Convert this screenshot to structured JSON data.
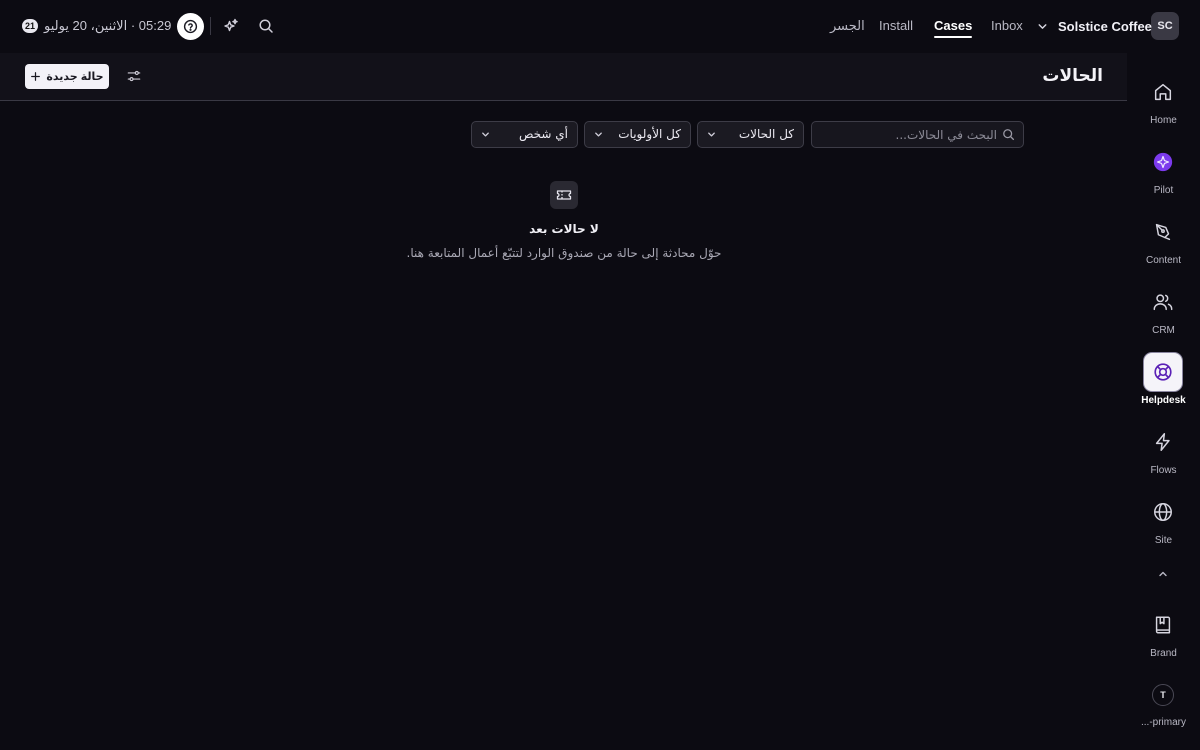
{
  "topbar": {
    "workspace_initials": "SC",
    "workspace_name": "Solstice Coffee",
    "tabs": [
      {
        "label": "Inbox",
        "active": false
      },
      {
        "label": "Cases",
        "active": true
      },
      {
        "label": "Install",
        "active": false
      },
      {
        "label": "الجسر",
        "active": false
      }
    ],
    "icons": [
      "chevron-down-icon",
      "search-icon",
      "sparkles-icon",
      "help-icon"
    ],
    "clock": "05:29 · الاثنين، 20 يوليو",
    "day_badge": "21"
  },
  "main": {
    "title": "الحالات",
    "new_case_label": "حالة جديدة",
    "search_placeholder": "البحث في الحالات...",
    "filters": {
      "status": "كل الحالات",
      "priority": "كل الأولويات",
      "assignee": "أي شخص"
    },
    "empty_state": {
      "title": "لا حالات بعد",
      "description": "حوّل محادثة إلى حالة من صندوق الوارد لتتبّع أعمال المتابعة هنا."
    }
  },
  "rail": {
    "items": [
      {
        "label": "Home",
        "icon": "home-icon",
        "active": false
      },
      {
        "label": "Pilot",
        "icon": "pilot-icon",
        "active": false
      },
      {
        "label": "Content",
        "icon": "pen-icon",
        "active": false
      },
      {
        "label": "CRM",
        "icon": "users-icon",
        "active": false
      },
      {
        "label": "Helpdesk",
        "icon": "lifebuoy-icon",
        "active": true
      },
      {
        "label": "Flows",
        "icon": "bolt-icon",
        "active": false
      },
      {
        "label": "Site",
        "icon": "globe-icon",
        "active": false
      },
      {
        "label": "Brand",
        "icon": "book-icon",
        "active": false
      }
    ],
    "user_initial": "T",
    "user_label": "...-primary"
  },
  "colors": {
    "background": "#0c0b12",
    "header": "#121119",
    "accent_purple": "#7c3aed",
    "active_icon_bg": "#f5f4f9"
  }
}
